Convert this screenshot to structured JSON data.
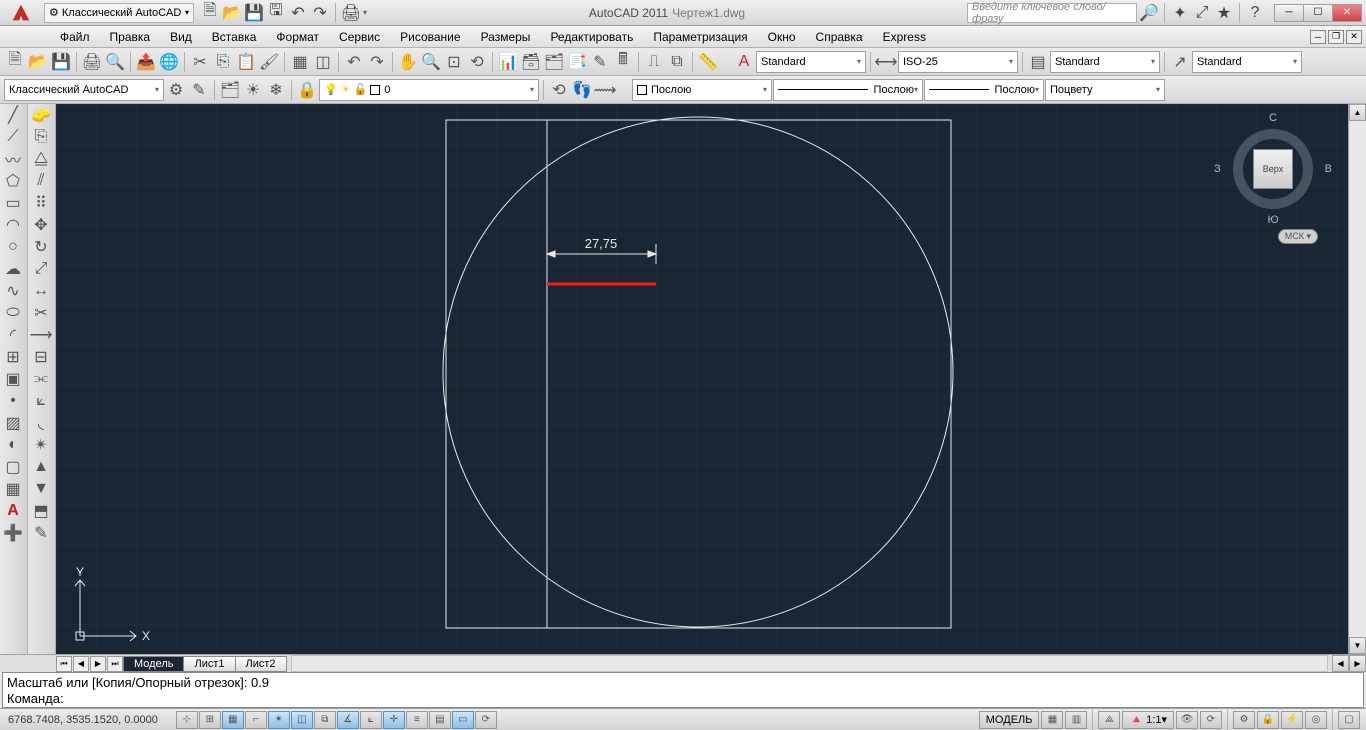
{
  "title": {
    "app": "AutoCAD 2011",
    "file": "Чертеж1.dwg"
  },
  "workspace_dd": "Классический AutoCAD",
  "search_placeholder": "Введите ключевое слово/фразу",
  "menu": [
    "Файл",
    "Правка",
    "Вид",
    "Вставка",
    "Формат",
    "Сервис",
    "Рисование",
    "Размеры",
    "Редактировать",
    "Параметризация",
    "Окно",
    "Справка",
    "Express"
  ],
  "row1": {
    "style_text": "Standard",
    "dim_style": "ISO-25",
    "std2": "Standard",
    "std3": "Standard"
  },
  "row2": {
    "ws_dd": "Классический AutoCAD",
    "layer": "0",
    "color": "Послою",
    "ltype": "Послою",
    "lweight": "Послою",
    "plot": "Поцвету"
  },
  "viewcube": {
    "face": "Верх",
    "n": "С",
    "s": "Ю",
    "e": "В",
    "w": "З",
    "msk": "МСК"
  },
  "dimension": "27,75",
  "tabs": {
    "model": "Модель",
    "sheets": [
      "Лист1",
      "Лист2"
    ]
  },
  "cmd": {
    "line1": "Масштаб или [Копия/Опорный отрезок]: 0.9",
    "line2": "Команда:"
  },
  "status": {
    "coords": "6768.7408, 3535.1520, 0.0000",
    "model_btn": "МОДЕЛЬ",
    "scale": "1:1"
  },
  "axes": {
    "x": "X",
    "y": "Y"
  },
  "chart_data": {
    "type": "diagram",
    "notes": "CAD drawing: square + circle + red horizontal segment with linear dimension 27.75"
  }
}
